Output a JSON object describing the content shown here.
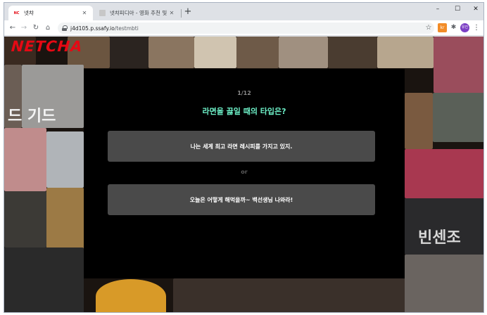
{
  "browser": {
    "tabs": [
      {
        "label": "넷챠",
        "favicon": "NC",
        "active": true
      },
      {
        "label": "넷챠피디아 - 영화 추천 및 평가",
        "favicon": "img",
        "active": false
      }
    ],
    "new_tab": "+",
    "window_controls": {
      "minimize": "–",
      "maximize": "☐",
      "close": "✕"
    },
    "url_host": "j4d105.p.ssafy.io",
    "url_path": "/testmbti",
    "extensions": {
      "ext1": "kr",
      "ext2": "puzzle-icon",
      "profile": "유진"
    },
    "menu": "⋮"
  },
  "app": {
    "logo": "NETCHA",
    "brand_color": "#e50914",
    "accent_color": "#6ef2c9"
  },
  "quiz": {
    "counter": "1/12",
    "question": "라면을 끓일 때의 타입은?",
    "answers": [
      "나는 세계 최고 라면 레시피를 가지고 있지.",
      "오늘은 어떻게 해먹을까~ 백선생님 나와라!"
    ],
    "separator": "or"
  },
  "background_text": {
    "left_poster": "드 기드",
    "right_poster": "빈센조"
  }
}
